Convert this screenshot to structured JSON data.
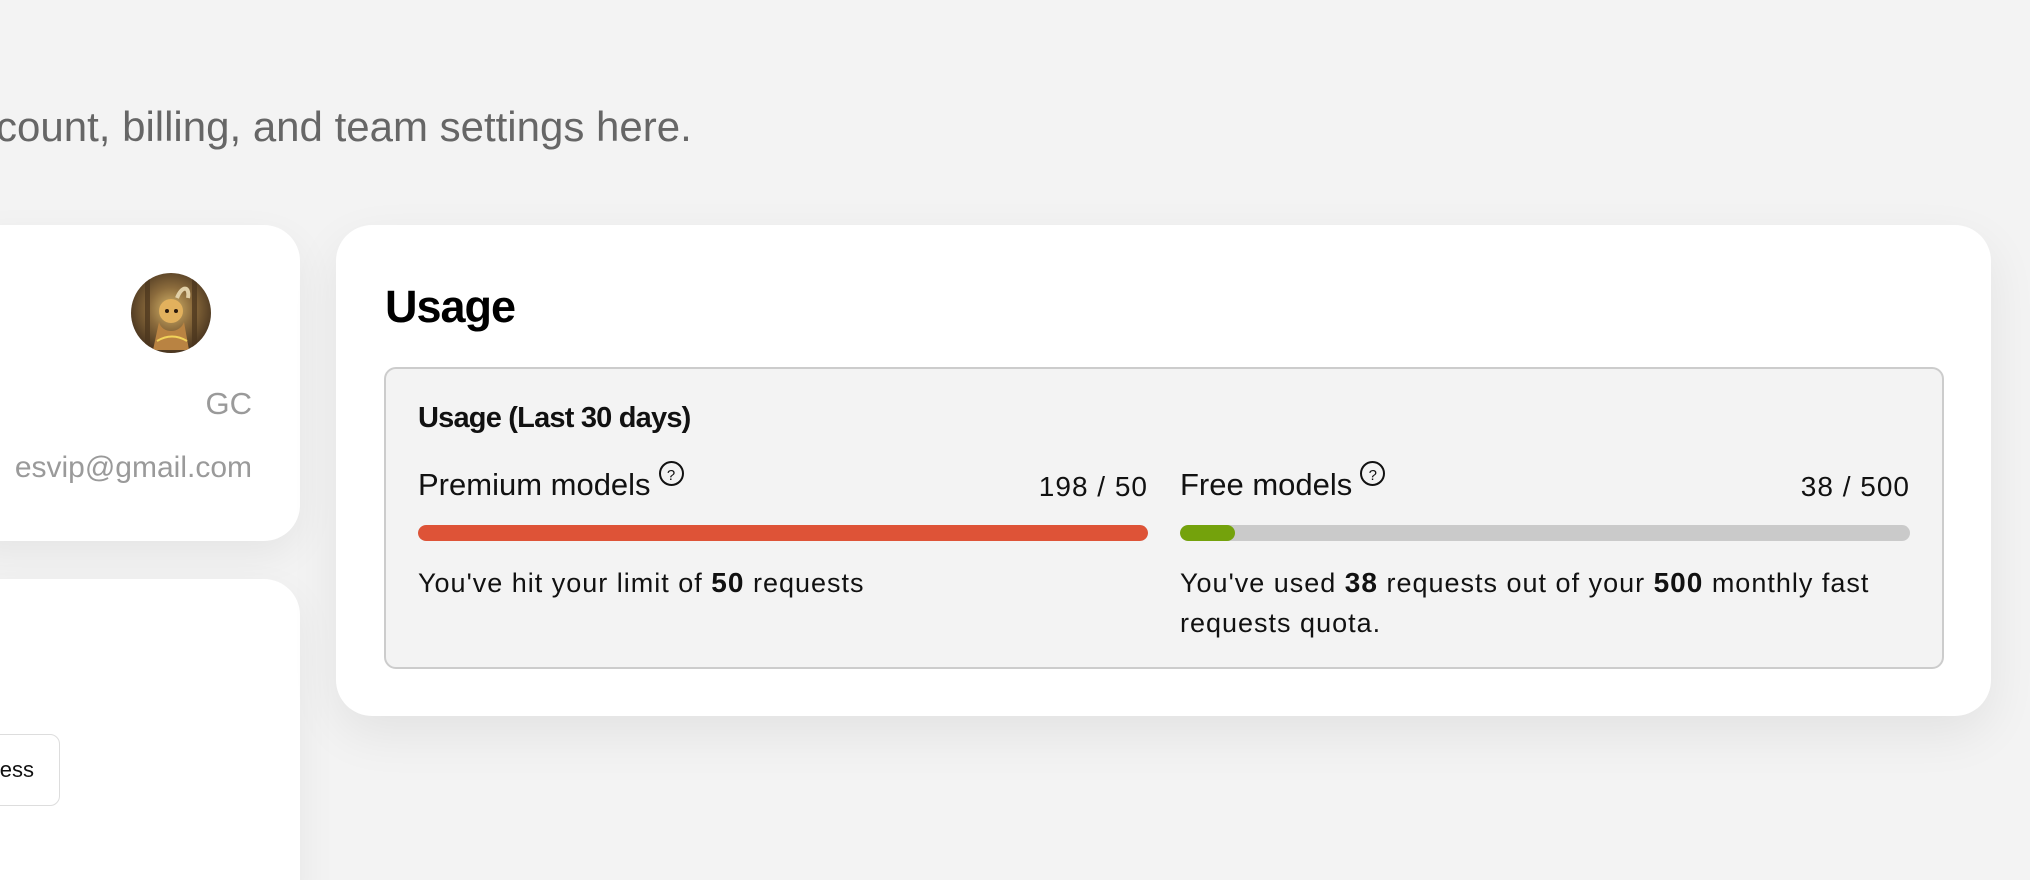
{
  "header": {
    "subtitle": "count, billing, and team settings here."
  },
  "profile": {
    "name": "GC",
    "email": "esvip@gmail.com",
    "avatar_icon": "avatar-photo"
  },
  "secondary_card": {
    "button_label": "ess"
  },
  "usage": {
    "title": "Usage",
    "box_title": "Usage (Last 30 days)",
    "premium": {
      "label": "Premium models",
      "help_icon": "question-icon",
      "count": "198 / 50",
      "used": 198,
      "limit": 50,
      "fill_fraction": 1,
      "bar_color": "#de5337",
      "note_prefix": "You've hit your limit of ",
      "note_value": "50",
      "note_suffix": " requests"
    },
    "free": {
      "label": "Free models",
      "help_icon": "question-icon",
      "count": "38 / 500",
      "used": 38,
      "limit": 500,
      "fill_fraction": 0.076,
      "bar_color": "#74a20c",
      "note_prefix": "You've used ",
      "note_used": "38",
      "note_middle": " requests out of your ",
      "note_limit": "500",
      "note_suffix": " monthly fast requests quota."
    }
  },
  "colors": {
    "background": "#f3f3f3",
    "card": "#ffffff",
    "track": "#cacaca"
  }
}
